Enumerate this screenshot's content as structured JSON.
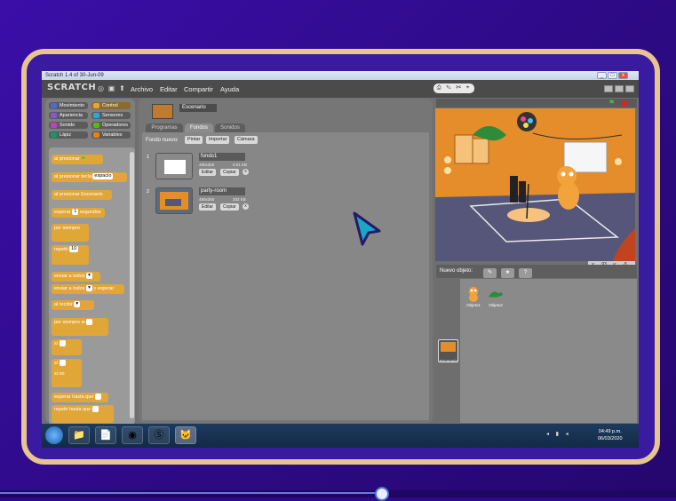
{
  "window": {
    "title": "Scratch 1.4 of 30-Jun-09",
    "min": "_",
    "max": "□",
    "close": "x"
  },
  "menu": {
    "logo": "SCRATCH",
    "items": [
      "Archivo",
      "Editar",
      "Compartir",
      "Ayuda"
    ],
    "tools": "⎙ ✎ ✂ ⌖"
  },
  "categories": [
    {
      "label": "Movimiento",
      "color": "#4a6cd4"
    },
    {
      "label": "Control",
      "color": "#e1a638"
    },
    {
      "label": "Apariencia",
      "color": "#8a55d7"
    },
    {
      "label": "Sensores",
      "color": "#2ca5e2"
    },
    {
      "label": "Sonido",
      "color": "#bb42c3"
    },
    {
      "label": "Operadores",
      "color": "#5cb712"
    },
    {
      "label": "Lápiz",
      "color": "#0e9a6c"
    },
    {
      "label": "Variables",
      "color": "#ee7d16"
    }
  ],
  "blocks": {
    "b1": "al presionar",
    "b2": "al presionar tecla",
    "b2slot": "espacio",
    "b3": "al presionar Escenario",
    "b4": "esperar",
    "b4slot": "1",
    "b4b": "segundos",
    "b5": "por siempre",
    "b6": "repetir",
    "b6slot": "10",
    "b7": "enviar a todos",
    "b8": "enviar a todos",
    "b8b": "y esperar",
    "b9": "al recibir",
    "b10": "por siempre si",
    "b11": "si",
    "b12": "si",
    "b12b": "si no",
    "b13": "esperar hasta que",
    "b14": "repetir hasta que"
  },
  "sprite": {
    "name": "Escenario"
  },
  "tabs": [
    "Programas",
    "Fondos",
    "Sonidos"
  ],
  "costumes": {
    "new_label": "Fondo nuevo:",
    "buttons": [
      "Pintar",
      "Importar",
      "Cámara"
    ],
    "items": [
      {
        "num": "1",
        "name": "fondo1",
        "dims": "480x360",
        "size": "0.01 KB",
        "edit": "Editar",
        "copy": "Copiar",
        "del": "x"
      },
      {
        "num": "2",
        "name": "party-room",
        "dims": "480x360",
        "size": "202 KB",
        "edit": "Editar",
        "copy": "Copiar",
        "del": "x"
      }
    ]
  },
  "coords": "x: 93 y: -5",
  "sprites": {
    "new_label": "Nuevo objeto:",
    "items": [
      "Objeto1",
      "Objeto2"
    ],
    "stage_label": "Escenario"
  },
  "taskbar": {
    "time": "04:49 p.m.",
    "date": "06/03/2020"
  },
  "colors": {
    "control": "#e1a638",
    "stage_floor": "#56567a",
    "stage_wall": "#e58d2a"
  }
}
